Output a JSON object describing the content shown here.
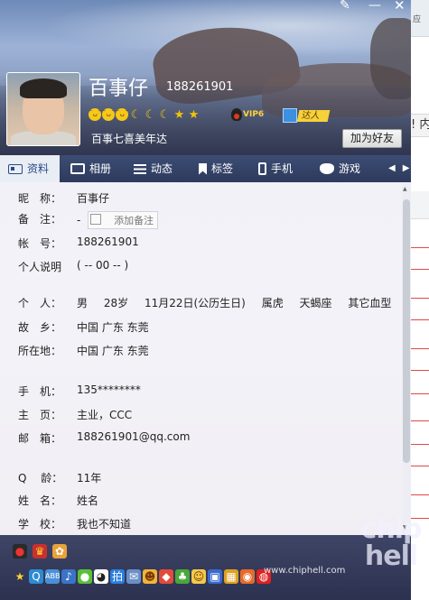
{
  "background_window": {
    "title_fragment": "应",
    "tab_fragment": "! 内"
  },
  "profile": {
    "nickname": "百事仔",
    "qq_number": "188261901",
    "signature": "百事七喜美年达",
    "add_friend_label": "加为好友",
    "vip_badge": "VIP6",
    "daren_badge": "达人",
    "level_icons": [
      "sun-face",
      "sun-face",
      "sun-face",
      "moon",
      "moon",
      "moon",
      "star",
      "star"
    ]
  },
  "tabs": [
    {
      "label": "资料",
      "active": true
    },
    {
      "label": "相册"
    },
    {
      "label": "动态"
    },
    {
      "label": "标签"
    },
    {
      "label": "手机"
    },
    {
      "label": "游戏"
    }
  ],
  "info": {
    "nickname_label": "昵　称：",
    "nickname_value": "百事仔",
    "remark_label": "备　注：",
    "remark_value": "-",
    "add_remark_label": "添加备注",
    "account_label": "帐　号：",
    "account_value": "188261901",
    "desc_label": "个人说明",
    "desc_value": "( -- 00 -- )",
    "personal_label": "个　人：",
    "gender": "男",
    "age": "28岁",
    "birthday": "11月22日(公历生日)",
    "zodiac": "属虎",
    "constellation": "天蝎座",
    "blood": "其它血型",
    "hometown_label": "故　乡：",
    "hometown_value": "中国 广东 东莞",
    "location_label": "所在地：",
    "location_value": "中国 广东 东莞",
    "phone_label": "手　机：",
    "phone_value": "135********",
    "homepage_label": "主　页：",
    "homepage_value": "主业，CCC",
    "email_label": "邮　箱：",
    "email_value": "188261901@qq.com",
    "qage_label": "Q　 龄：",
    "qage_value": "11年",
    "name_label": "姓　名：",
    "name_value": "姓名",
    "school_label": "学　校：",
    "school_value": "我也不知道"
  },
  "footer": {
    "watermark": "www.chiphell.com",
    "logo_line1": "chip",
    "logo_line2": "hell"
  },
  "colors": {
    "tab_bar": "#2d3a5d",
    "active_tab_text": "#2a4a8a",
    "bottom_bar": "#2c3150"
  }
}
